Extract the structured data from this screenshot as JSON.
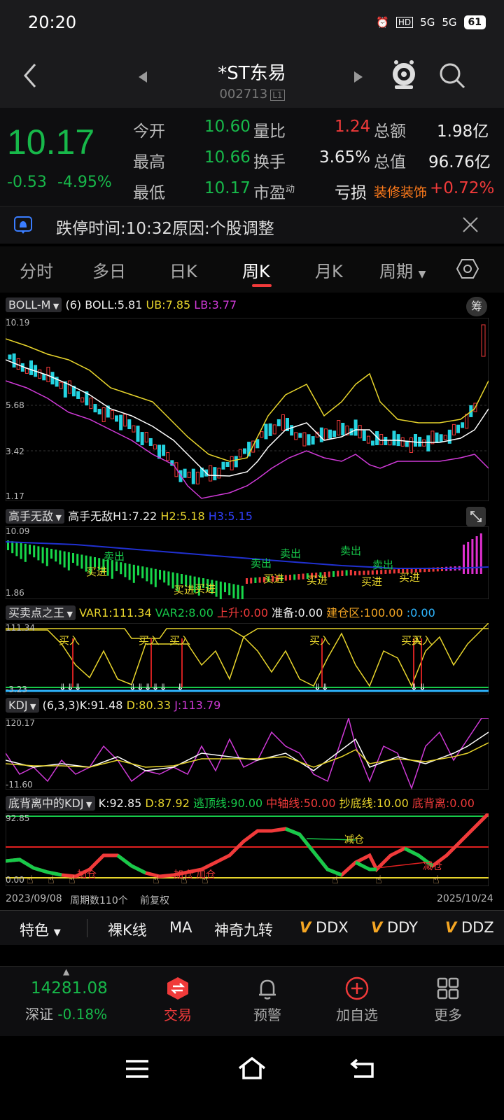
{
  "status_bar": {
    "time": "20:20",
    "battery": "61",
    "signal1": "5G",
    "signal2": "5G",
    "hd": "HD"
  },
  "header": {
    "title": "*ST东易",
    "code": "002713",
    "code_badge": "L1"
  },
  "quote": {
    "price": "10.17",
    "change": "-0.53",
    "change_pct": "-4.95%",
    "rows": [
      {
        "l1": "今开",
        "v1": "10.60",
        "l2": "量比",
        "v2": "1.24",
        "l3": "总额",
        "v3": "1.98亿"
      },
      {
        "l1": "最高",
        "v1": "10.66",
        "l2": "换手",
        "v2": "3.65%",
        "l3": "总值",
        "v3": "96.76亿"
      },
      {
        "l1": "最低",
        "v1": "10.17",
        "l2": "市盈",
        "l2sup": "动",
        "v2": "",
        "l3": "亏损",
        "v3": "装修装饰",
        "v4": "+0.72%"
      }
    ]
  },
  "notice": {
    "text": "跌停时间:10:32原因:个股调整"
  },
  "tabs": [
    "分时",
    "多日",
    "日K",
    "周K",
    "月K",
    "周期"
  ],
  "active_tab": "周K",
  "boll": {
    "name": "BOLL-M",
    "param": "(6)",
    "boll": "BOLL:5.81",
    "ub": "UB:7.85",
    "lb": "LB:3.77",
    "chip_label": "筹",
    "axis": [
      "10.19",
      "5.68",
      "3.42",
      "1.17"
    ]
  },
  "gswd": {
    "name": "高手无敌",
    "h1": "高手无敌H1:7.22",
    "h2": "H2:5.18",
    "h3": "H3:5.15",
    "axis_top": "10.09",
    "axis_bottom": "1.86",
    "labels": [
      "卖出",
      "卖出",
      "卖出",
      "卖出",
      "卖出",
      "买进",
      "买进",
      "买进",
      "买进",
      "买进",
      "买进",
      "买进"
    ]
  },
  "mmd": {
    "name": "买卖点之王",
    "var1": "VAR1:111.34",
    "var2": "VAR2:8.00",
    "rise": "上升:0.00",
    "ready": "准备:0.00",
    "zone": "建仓区:100.00",
    "extra": ":0.00",
    "axis_top": "111.34",
    "axis_bottom": "-3.23",
    "buy_label": "买入"
  },
  "kdj": {
    "name": "KDJ",
    "param": "(6,3,3)",
    "k": "K:91.48",
    "d": "D:80.33",
    "j": "J:113.79",
    "axis_top": "120.17",
    "axis_bottom": "-11.60"
  },
  "dbl": {
    "name": "底背离中的KDJ",
    "k": "K:92.85",
    "d": "D:87.92",
    "top": "逃顶线:90.00",
    "mid": "中轴线:50.00",
    "low": "抄底线:10.00",
    "div": "底背离:0.00",
    "axis_top": "92.85",
    "axis_bottom": "0.00",
    "labels": [
      "减仓",
      "加仓",
      "加仓",
      "加仓",
      "减仓"
    ]
  },
  "chart_footer": {
    "start": "2023/09/08",
    "count": "周期数110个",
    "adj": "前复权",
    "end": "2025/10/24"
  },
  "toolbar": {
    "special": "特色",
    "items": [
      "裸K线",
      "MA",
      "神奇九转",
      "DDX",
      "DDY",
      "DDZ"
    ],
    "v_mark": "V"
  },
  "bottom": {
    "index_value": "14281.08",
    "index_name": "深证",
    "index_pct": "-0.18%",
    "nav": [
      "交易",
      "预警",
      "加自选",
      "更多"
    ]
  },
  "colors": {
    "up": "#f03a3a",
    "down": "#17b84a",
    "ub": "#e8d52c",
    "lb": "#d03ad8",
    "mid": "#ffffff"
  }
}
